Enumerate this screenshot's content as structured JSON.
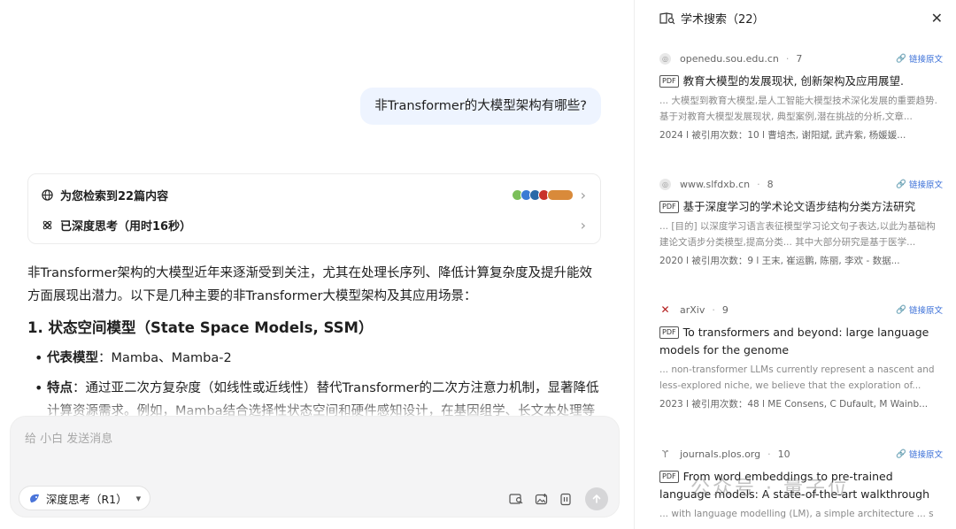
{
  "chat": {
    "user_message": "非Transformer的大模型架构有哪些?",
    "search_summary": "为您检索到22篇内容",
    "thinking_summary": "已深度思考（用时16秒）",
    "answer": {
      "intro": "非Transformer架构的大模型近年来逐渐受到关注，尤其在处理长序列、降低计算复杂度及提升能效方面展现出潜力。以下是几种主要的非Transformer大模型架构及其应用场景：",
      "section1_title": "1. 状态空间模型（State Space Models, SSM）",
      "bullets": [
        {
          "label": "代表模型",
          "text": "：Mamba、Mamba-2"
        },
        {
          "label": "特点",
          "text": "：通过亚二次方复杂度（如线性或近线性）替代Transformer的二次方注意力机制，显著降低计算资源需求。例如，Mamba结合选择性状态空间和硬件感知设计，在基因组学、长文本处理等"
        }
      ]
    },
    "input": {
      "placeholder": "给 小白 发送消息",
      "deep_think_label": "深度思考（R1）"
    }
  },
  "panel": {
    "title": "学术搜索（22）",
    "link_label": "链接原文",
    "results": [
      {
        "source": "openedu.sou.edu.cn",
        "index": "7",
        "badge": "PDF",
        "title": "教育大模型的发展现状, 创新架构及应用展望.",
        "snippet": "... 大模型到教育大模型,是人工智能大模型技术深化发展的重要趋势.基于对教育大模型发展现状, 典型案例,潜在挑战的分析,文章...",
        "meta": "2024 l  被引用次数：10 l  曹培杰,  谢阳斌,  武卉紫,  杨媛媛..."
      },
      {
        "source": "www.slfdxb.cn",
        "index": "8",
        "badge": "PDF",
        "title": "基于深度学习的学术论文语步结构分类方法研究",
        "snippet": "... [目的] 以深度学习语言表征模型学习论文句子表达,以此为基础构建论文语步分类模型,提高分类... 其中大部分研究是基于医学...",
        "meta": "2020 l  被引用次数：9 l  王末,  崔运鹏,  陈丽,  李欢 - 数据..."
      },
      {
        "source": "arXiv",
        "index": "9",
        "badge": "PDF",
        "title": "To transformers and beyond: large language models for the genome",
        "snippet": "... non-transformer LLMs currently represent a nascent and less-explored niche, we believe that the exploration of...",
        "meta": "2023 l  被引用次数：48 l  ME Consens, C Dufault, M Wainb..."
      },
      {
        "source": "journals.plos.org",
        "index": "10",
        "badge": "PDF",
        "title": "From word embeddings to pre-trained language models: A state-of-the-art walkthrough",
        "snippet": "... with language modelling (LM), a simple architecture ... s"
      }
    ]
  },
  "watermark": "公众号 · 量子位",
  "colors": {
    "accent_link": "#3a6fd8",
    "user_bubble": "#eef4ff",
    "input_bg": "#f4f4f5"
  }
}
